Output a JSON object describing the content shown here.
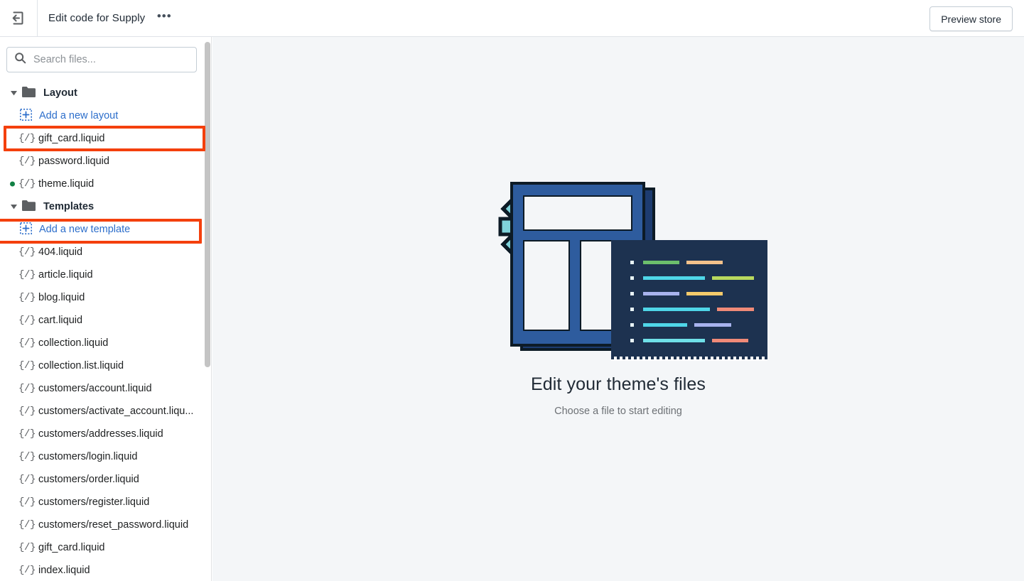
{
  "header": {
    "back_icon": "exit-back-icon",
    "title": "Edit code for Supply",
    "more_menu": "•••",
    "preview_label": "Preview store"
  },
  "search": {
    "icon": "search-icon",
    "placeholder": "Search files...",
    "value": ""
  },
  "sidebar": {
    "groups": [
      {
        "name": "Layout",
        "label": "Layout",
        "add_label": "Add a new layout",
        "files": [
          {
            "name": "gift_card.liquid",
            "modified": false
          },
          {
            "name": "password.liquid",
            "modified": false
          },
          {
            "name": "theme.liquid",
            "modified": true
          }
        ]
      },
      {
        "name": "Templates",
        "label": "Templates",
        "add_label": "Add a new template",
        "files": [
          {
            "name": "404.liquid",
            "modified": false
          },
          {
            "name": "article.liquid",
            "modified": false
          },
          {
            "name": "blog.liquid",
            "modified": false
          },
          {
            "name": "cart.liquid",
            "modified": false
          },
          {
            "name": "collection.liquid",
            "modified": false
          },
          {
            "name": "collection.list.liquid",
            "modified": false
          },
          {
            "name": "customers/account.liquid",
            "modified": false
          },
          {
            "name": "customers/activate_account.liqu...",
            "modified": false
          },
          {
            "name": "customers/addresses.liquid",
            "modified": false
          },
          {
            "name": "customers/login.liquid",
            "modified": false
          },
          {
            "name": "customers/order.liquid",
            "modified": false
          },
          {
            "name": "customers/register.liquid",
            "modified": false
          },
          {
            "name": "customers/reset_password.liquid",
            "modified": false
          },
          {
            "name": "gift_card.liquid",
            "modified": false
          },
          {
            "name": "index.liquid",
            "modified": false
          }
        ]
      }
    ],
    "file_icon": "{/}"
  },
  "main": {
    "illustration": "theme-files-illustration",
    "title": "Edit your theme's files",
    "subtitle": "Choose a file to start editing"
  },
  "annotations": [
    {
      "name": "layout-folder-highlight",
      "color": "#f4400d"
    },
    {
      "name": "theme-liquid-highlight",
      "color": "#f4400d"
    }
  ],
  "colors": {
    "annotation": "#f4400d",
    "link": "#2c6ecb",
    "modified_dot": "#108043",
    "canvas_bg": "#f4f6f8",
    "illus_blue": "#2e5c9e",
    "illus_teal": "#7fd2da",
    "illus_navy": "#1d3250"
  }
}
